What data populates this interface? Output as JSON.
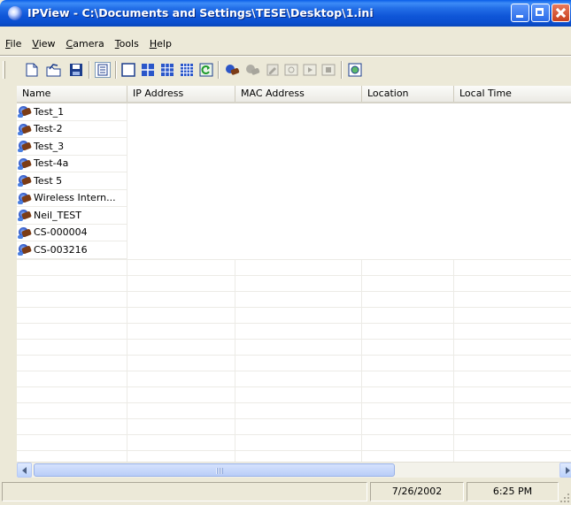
{
  "window": {
    "title": "IPView - C:\\Documents and Settings\\TESE\\Desktop\\1.ini"
  },
  "menu": [
    {
      "key": "F",
      "rest": "ile"
    },
    {
      "key": "V",
      "rest": "iew"
    },
    {
      "key": "C",
      "rest": "amera"
    },
    {
      "key": "T",
      "rest": "ools"
    },
    {
      "key": "H",
      "rest": "elp"
    }
  ],
  "toolbar": {
    "icons": [
      "new-file-icon",
      "open-folder-icon",
      "save-icon",
      "details-view-icon",
      "single-view-icon",
      "quad-view-icon",
      "nine-view-icon",
      "sixteen-view-icon",
      "refresh-icon",
      "connect-camera-icon",
      "disconnect-camera-icon",
      "properties-icon",
      "snapshot-icon",
      "play-icon",
      "stop-icon",
      "about-icon"
    ]
  },
  "table": {
    "columns": [
      "Name",
      "IP Address",
      "MAC Address",
      "Location",
      "Local Time"
    ],
    "rows": [
      {
        "name": "Test_1"
      },
      {
        "name": "Test-2"
      },
      {
        "name": "Test_3"
      },
      {
        "name": "Test-4a"
      },
      {
        "name": "Test 5"
      },
      {
        "name": "Wireless Intern..."
      },
      {
        "name": "Neil_TEST"
      },
      {
        "name": "CS-000004"
      },
      {
        "name": "CS-003216"
      }
    ]
  },
  "statusbar": {
    "date": "7/26/2002",
    "time": "6:25 PM"
  }
}
